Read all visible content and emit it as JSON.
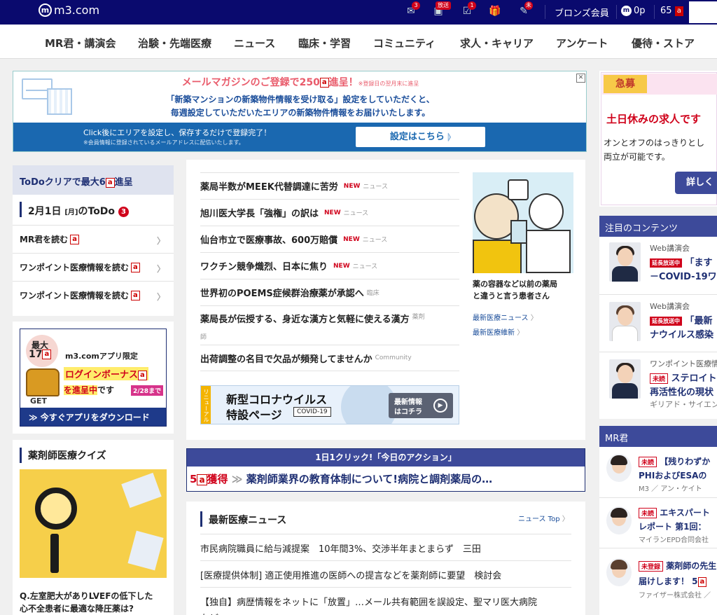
{
  "topbar": {
    "logo": "m3.com",
    "broadcast_badge": "放送",
    "mail_badge": "3",
    "todo_badge": "1",
    "unread_badge": "未",
    "member_rank": "ブロンズ会員",
    "points": "0p",
    "score": "65",
    "score_unit": "a"
  },
  "nav": [
    "MR君・講演会",
    "治験・先端医療",
    "ニュース",
    "臨床・学習",
    "コミュニティ",
    "求人・キャリア",
    "アンケート",
    "優待・ストア"
  ],
  "mail_banner": {
    "headline_pre": "メールマガジンのご登録で250",
    "headline_unit": "a",
    "headline_post": "進呈！",
    "headline_note": "※登録日の翌月末に進呈",
    "line1": "「新築マンションの新築物件情報を受け取る」設定をしていただくと、",
    "line2": "毎週設定していただいたエリアの新築物件情報をお届けいたします。",
    "sub1": "Click後にエリアを設定し、保存するだけで登録完了！",
    "sub2": "※会員情報に登録されているメールアドレスに配信いたします。",
    "button": "設定はこちら",
    "close": "✕"
  },
  "todo": {
    "header_pre": "ToDoクリアで最大6",
    "header_unit": "a",
    "header_post": "進呈",
    "date_label": "2月1日",
    "weekday": "[月]",
    "todo_label": "のToDo",
    "count": "3",
    "items": [
      {
        "label": "MR君を読む",
        "unit": "a"
      },
      {
        "label": "ワンポイント医療情報を読む",
        "unit": "a"
      },
      {
        "label": "ワンポイント医療情報を読む",
        "unit": "a"
      }
    ]
  },
  "app_promo": {
    "max_label": "最大",
    "max_value": "17",
    "max_unit": "a",
    "get_label": "GET",
    "limited": "m3.comアプリ限定",
    "bonus": "ログインボーナス",
    "bonus_unit": "a",
    "progress": "を進呈中",
    "desu": "です",
    "deadline": "2/28まで",
    "cta": "≫ 今すぐアプリをダウンロード"
  },
  "quiz": {
    "title": "薬剤師医療クイズ",
    "q1": "Q.左室肥大がありLVEFの低下した",
    "q2": "心不全患者に最適な降圧薬は?"
  },
  "top_news": [
    {
      "title": "薬局半数がMEEK代替調達に苦労",
      "tag": "NEW",
      "cat": "ニュース"
    },
    {
      "title": "旭川医大学長「強権」の訳は",
      "tag": "NEW",
      "cat": "ニュース"
    },
    {
      "title": "仙台市立で医療事故、600万賠償",
      "tag": "NEW",
      "cat": "ニュース"
    },
    {
      "title": "ワクチン競争熾烈、日本に焦り",
      "tag": "NEW",
      "cat": "ニュース"
    },
    {
      "title": "世界初のPOEMS症候群治療薬が承認へ",
      "tag": "",
      "cat": "臨床"
    },
    {
      "title": "薬局長が伝授する、身近な漢方と気軽に使える漢方",
      "tag": "",
      "cat": "薬剤"
    },
    {
      "title": "師",
      "tag": "",
      "cat": ""
    },
    {
      "title": "出荷調整の名目で欠品が頻発してませんか",
      "tag": "",
      "cat": "Community"
    }
  ],
  "feature": {
    "caption1": "薬の容器など以前の薬局",
    "caption2": "と違うと言う患者さん",
    "link1": "最新医療ニュース",
    "link2": "最新医療維新"
  },
  "covid_banner": {
    "ribbon": "リニューアル",
    "line1": "新型コロナウイルス",
    "line2": "特設ページ",
    "tag": "COVID-19",
    "btn1": "最新情報",
    "btn2": "はコチラ"
  },
  "action": {
    "header": "1日1クリック!「今日のアクション」",
    "points": "5",
    "unit": "a",
    "get": "獲得",
    "arrow": "≫",
    "text": "薬剤師業界の教育体制について!病院と調剤薬局の…"
  },
  "latest": {
    "title": "最新医療ニュース",
    "top_link": "ニュース Top",
    "items": [
      "市民病院職員に給与減提案　10年間3%、交渉半年まとまらず　三田",
      "[医療提供体制] 適正使用推進の医師への提言などを薬剤師に要望　検討会",
      "【独自】病歴情報をネットに「放置」…メール共有範囲を誤設定、聖マリ医大病院",
      "など"
    ]
  },
  "recruit": {
    "badge": "急募",
    "title": "土日休みの求人です",
    "body1": "オンとオフのはっきりとし",
    "body2": "両立が可能です。",
    "button": "詳しく"
  },
  "featured": {
    "title": "注目のコンテンツ",
    "items": [
      {
        "label": "Web講演会",
        "tag": "延長放送中",
        "t1": "「ます",
        "t2": "－COVID-19ワ"
      },
      {
        "label": "Web講演会",
        "tag": "延長放送中",
        "t1": "「最新",
        "t2": "ナウイルス感染"
      },
      {
        "label": "ワンポイント医療情",
        "tag": "未読",
        "t1": "ステロイト",
        "t2": "再活性化の現状",
        "sponsor": "ギリアド・サイエン"
      }
    ]
  },
  "mr": {
    "title": "MR君",
    "items": [
      {
        "tag": "未読",
        "t1": "【残りわずか",
        "t2": "PHIおよびESAの",
        "sponsor": "M3 ／ アン・ケイト"
      },
      {
        "tag": "未読",
        "t1": "エキスパート",
        "t2": "レポート 第1回：",
        "sponsor": "マイランEPD合同会社"
      },
      {
        "tag": "未登録",
        "t1": "薬剤師の先生",
        "t2": "届けします！ 5",
        "t2_unit": "a",
        "sponsor": "ファイザー株式会社 ／"
      }
    ]
  }
}
